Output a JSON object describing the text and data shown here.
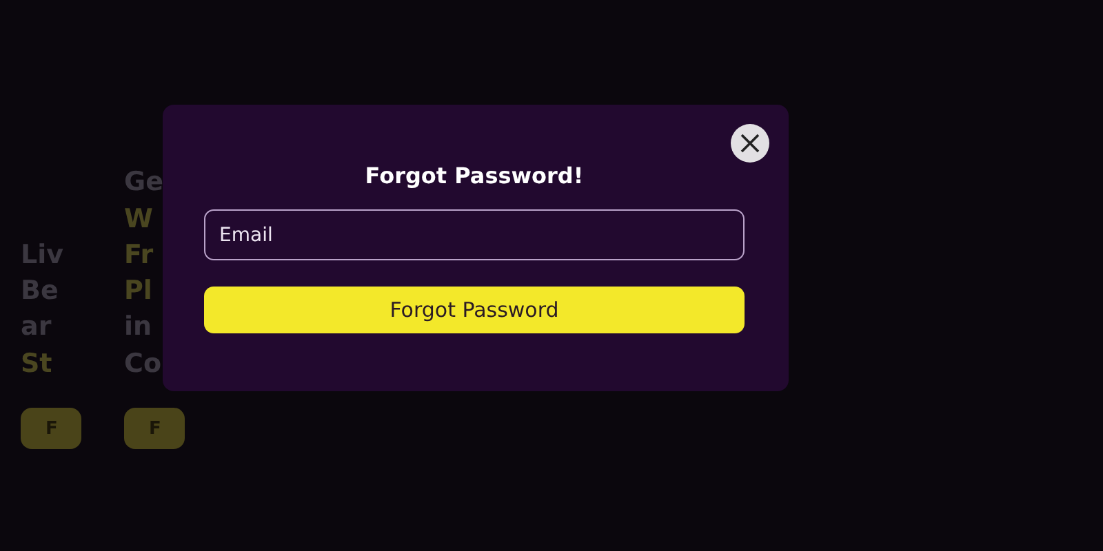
{
  "background_cards": [
    {
      "lines": [
        {
          "text": "Liv",
          "highlight": false
        },
        {
          "text": "Be",
          "highlight": false
        },
        {
          "text": "ar",
          "highlight": false
        },
        {
          "text": "St",
          "highlight": true
        }
      ],
      "button": "F"
    },
    {
      "lines": [
        {
          "text": "Ge",
          "highlight": false
        },
        {
          "text": "W",
          "highlight": true
        },
        {
          "text": "Fr",
          "highlight": true
        },
        {
          "text": "Pl",
          "highlight": true
        },
        {
          "text": "in",
          "highlight": false
        },
        {
          "text": "Co",
          "highlight": false
        }
      ],
      "button": "F"
    }
  ],
  "dialog": {
    "title": "Forgot Password!",
    "email_field": {
      "placeholder": "Email"
    },
    "submit_button": "Forgot Password"
  }
}
